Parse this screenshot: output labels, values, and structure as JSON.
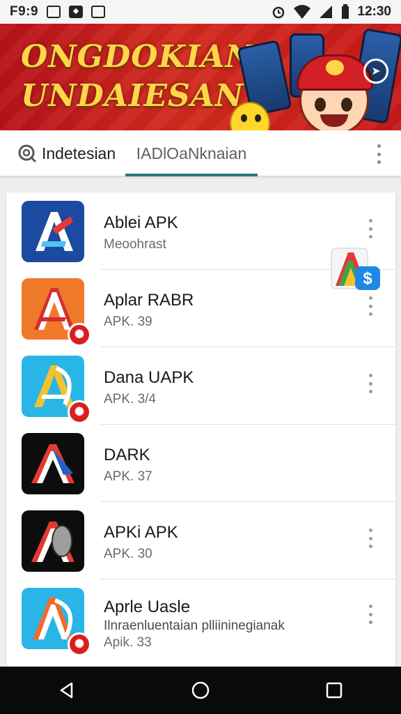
{
  "status_bar": {
    "time": "F9:9",
    "clock": "12:30",
    "icons": [
      "gallery-icon",
      "notification-icon",
      "sync-icon",
      "alarm-icon",
      "wifi-icon",
      "signal-icon",
      "battery-icon"
    ]
  },
  "banner": {
    "title_line1": "ONGDOKIAN",
    "title_line2": "UNDAIESAN"
  },
  "tabs": [
    {
      "label": "Indetesian"
    },
    {
      "label": "IADlOaNknaian",
      "selected": true
    }
  ],
  "apps": [
    {
      "title": "Ablei APK",
      "subtitle": "Meoohrast",
      "icon": "blue-a-icon",
      "badge": false
    },
    {
      "title": "Aplar RABR",
      "subtitle": "APK. 39",
      "icon": "orange-a-icon",
      "badge": true
    },
    {
      "title": "Dana UAPK",
      "subtitle": "APK. 3/4",
      "icon": "cyan-a-icon",
      "badge": true
    },
    {
      "title": "DARK",
      "subtitle": "APK. 37",
      "icon": "black-a-icon",
      "badge": false,
      "action_icon": "colorful-a-dollar-icon"
    },
    {
      "title": "APKi APK",
      "subtitle": "APK. 30",
      "icon": "black-leaf-a-icon",
      "badge": false
    },
    {
      "title": "Aprle Uasle",
      "extra": "Ilnraenluentaian plliininegianak",
      "subtitle": "Apik. 33",
      "icon": "cyan-outline-a-icon",
      "badge": true
    }
  ],
  "colors": {
    "accent": "#2a7a7a",
    "banner_red": "#c81a1a",
    "badge_red": "#d81f1f"
  }
}
